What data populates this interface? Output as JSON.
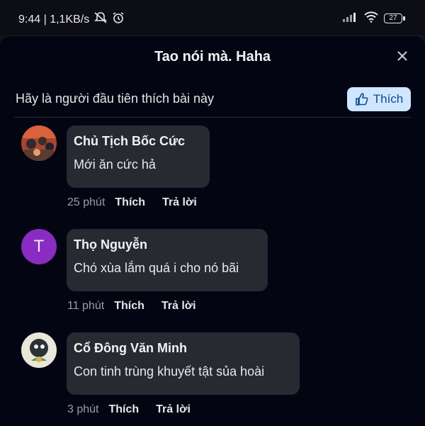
{
  "status_bar": {
    "time_speed": "9:44 | 1,1KB/s",
    "battery": "27"
  },
  "sheet": {
    "title": "Tao nói mà. Haha",
    "likes_prompt": "Hãy là người đầu tiên thích bài này",
    "like_button": "Thích"
  },
  "comments": [
    {
      "name": "Chủ Tịch Bốc Cức",
      "text": "Mới ăn cức hả",
      "time": "25 phút",
      "like": "Thích",
      "reply": "Trả lời"
    },
    {
      "name": "Thọ Nguyễn",
      "text": "Chó xùa lắm quá i cho nó bãi",
      "time": "11 phút",
      "like": "Thích",
      "reply": "Trả lời",
      "avatar_letter": "T"
    },
    {
      "name": "Cổ Đông Văn Minh",
      "text": "Con tinh trùng khuyết tật sủa hoài",
      "time": "3 phút",
      "like": "Thích",
      "reply": "Trả lời"
    }
  ],
  "colors": {
    "background": "#030612",
    "bubble": "#272a31",
    "like_button_bg": "#cfe6ff",
    "avatar_t": "#8a2bc2"
  },
  "icons": [
    "mute-icon",
    "alarm-icon",
    "signal-icon",
    "wifi-icon",
    "battery-icon",
    "close-icon",
    "thumbs-up-icon"
  ]
}
